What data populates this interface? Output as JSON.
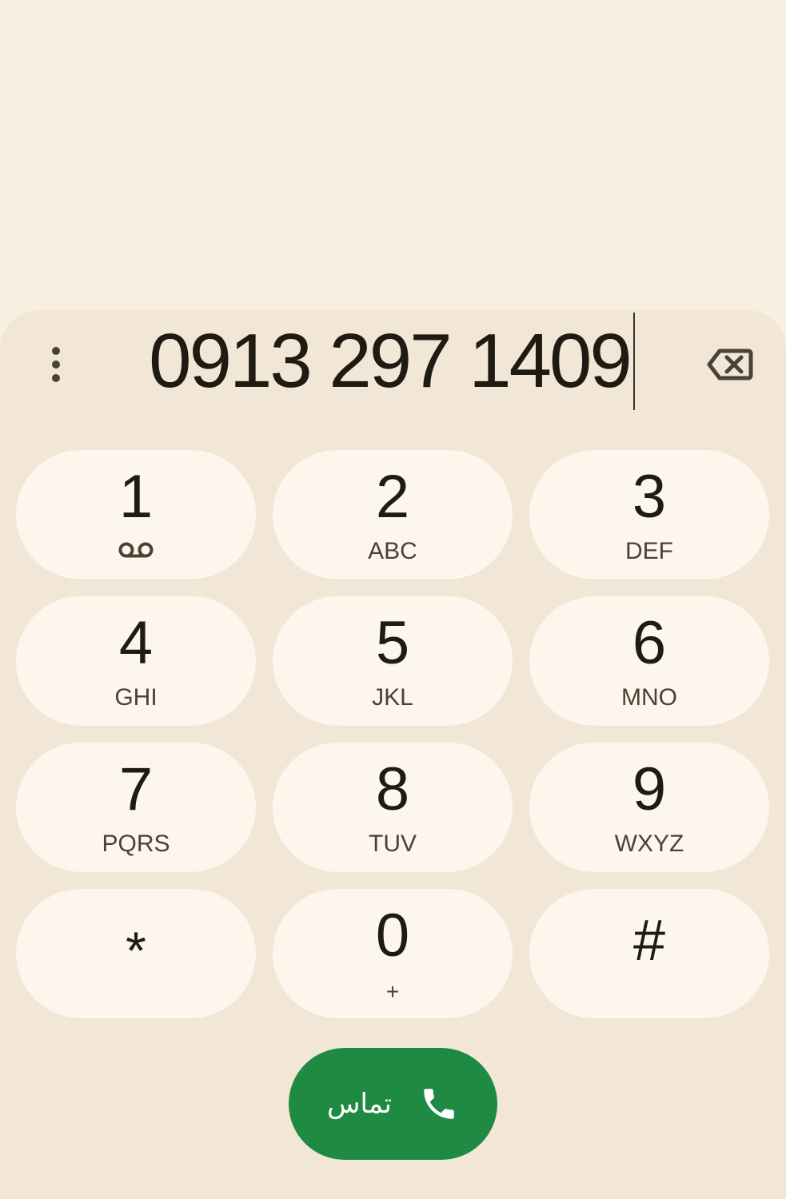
{
  "dialer": {
    "number": "0913 297 1409",
    "more_icon": "more-vert-icon",
    "backspace_icon": "backspace-icon"
  },
  "keypad": {
    "keys": [
      {
        "digit": "1",
        "letters": "",
        "sub_icon": "voicemail-icon"
      },
      {
        "digit": "2",
        "letters": "ABC"
      },
      {
        "digit": "3",
        "letters": "DEF"
      },
      {
        "digit": "4",
        "letters": "GHI"
      },
      {
        "digit": "5",
        "letters": "JKL"
      },
      {
        "digit": "6",
        "letters": "MNO"
      },
      {
        "digit": "7",
        "letters": "PQRS"
      },
      {
        "digit": "8",
        "letters": "TUV"
      },
      {
        "digit": "9",
        "letters": "WXYZ"
      },
      {
        "digit": "*",
        "letters": ""
      },
      {
        "digit": "0",
        "letters": "+"
      },
      {
        "digit": "#",
        "letters": ""
      }
    ]
  },
  "call": {
    "label": "تماس",
    "icon": "phone-icon"
  },
  "colors": {
    "background": "#f8efe0",
    "sheet": "#f2e7d7",
    "key": "#fcf6ec",
    "call_green": "#1f8a41",
    "text": "#1f1a12"
  }
}
